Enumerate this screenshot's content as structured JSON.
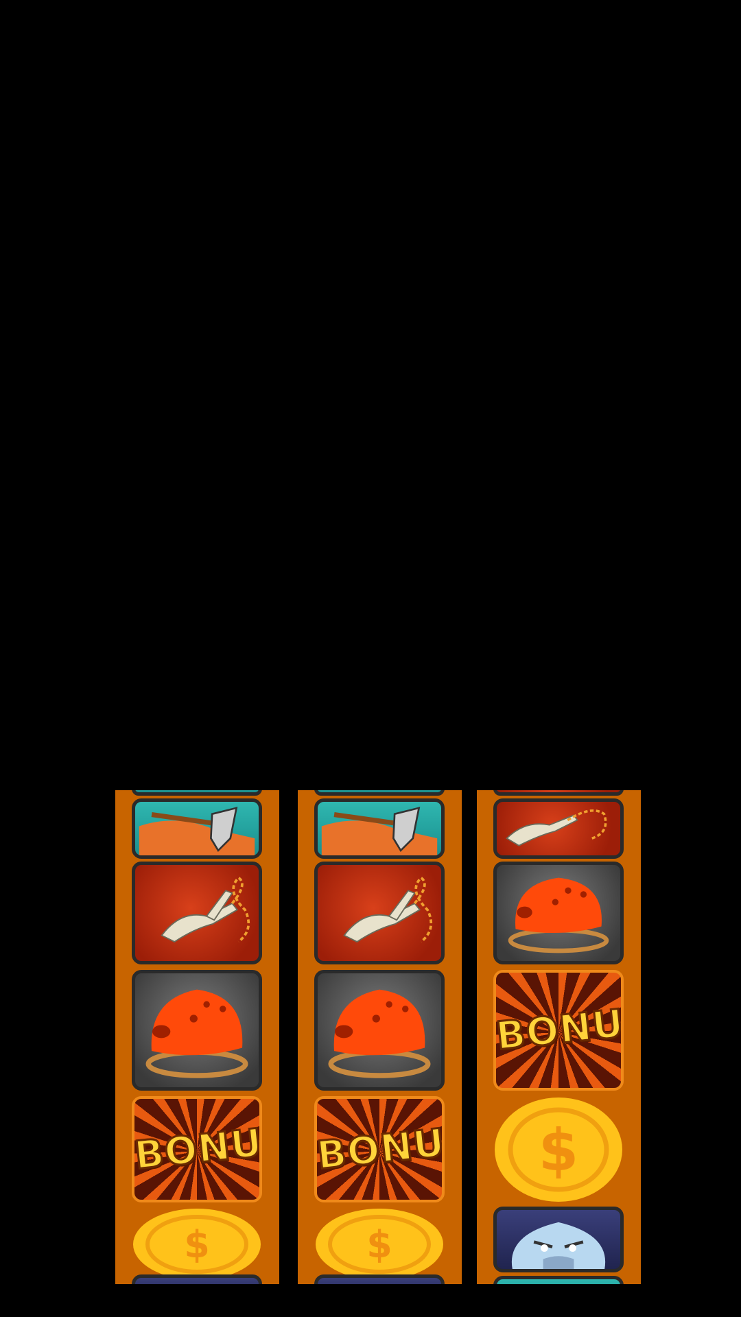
{
  "game": {
    "reels": [
      {
        "symbols": [
          "pick-axe",
          "grappling-anchor",
          "climbing-helmet",
          "bonus",
          "gold-coin",
          "yeti"
        ]
      },
      {
        "symbols": [
          "pick-axe",
          "grappling-anchor",
          "climbing-helmet",
          "bonus",
          "gold-coin",
          "yeti"
        ]
      },
      {
        "symbols": [
          "grappling-anchor",
          "climbing-helmet",
          "bonus",
          "gold-coin",
          "yeti",
          "pick-axe"
        ]
      }
    ],
    "bonus_label": "BONUS",
    "coin_label": "$",
    "colors": {
      "background": "#000000",
      "reel": "#c86400",
      "bonus_text": "#ffd43a",
      "coin": "#ffc21a"
    }
  }
}
